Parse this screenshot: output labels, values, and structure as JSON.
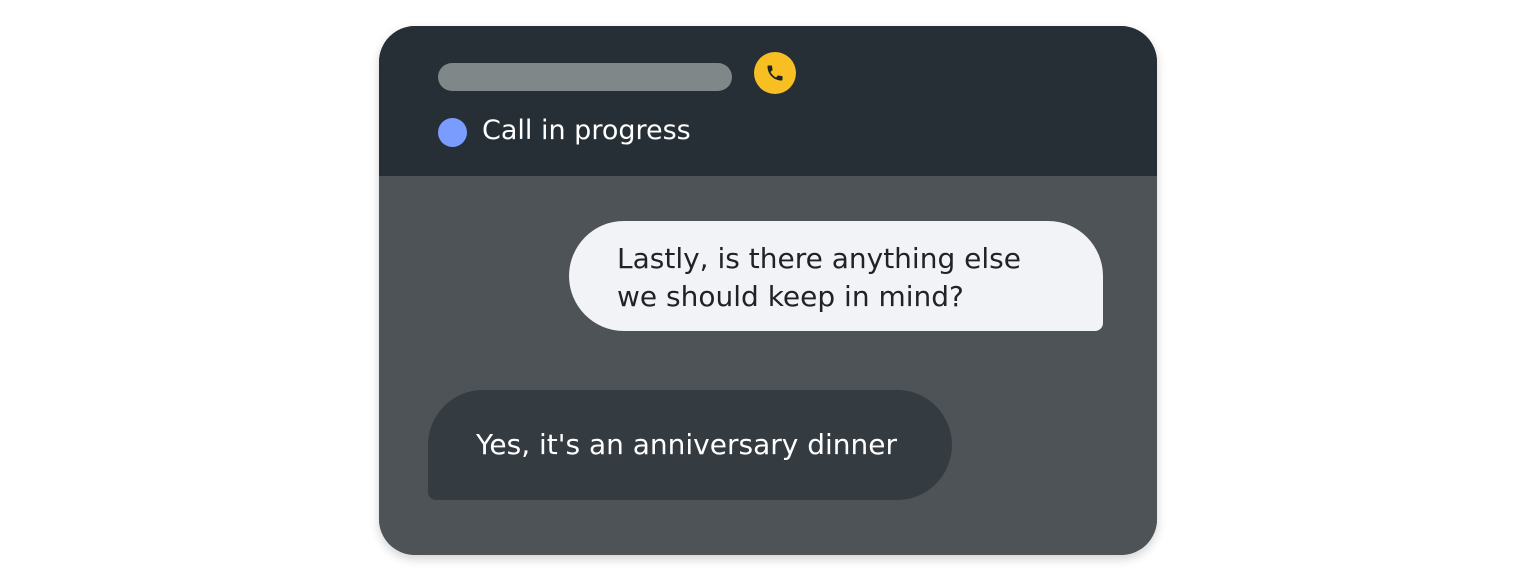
{
  "header": {
    "phone_icon": "phone-icon",
    "phone_button_color": "#f7bf21",
    "status_text": "Call in progress",
    "status_dot_color": "#7b9cff"
  },
  "conversation": {
    "messages": [
      {
        "sender": "agent",
        "lines": [
          "Lastly, is there anything else",
          "we should keep in mind?"
        ]
      },
      {
        "sender": "user",
        "lines": [
          "Yes, it's an anniversary dinner"
        ]
      }
    ]
  }
}
